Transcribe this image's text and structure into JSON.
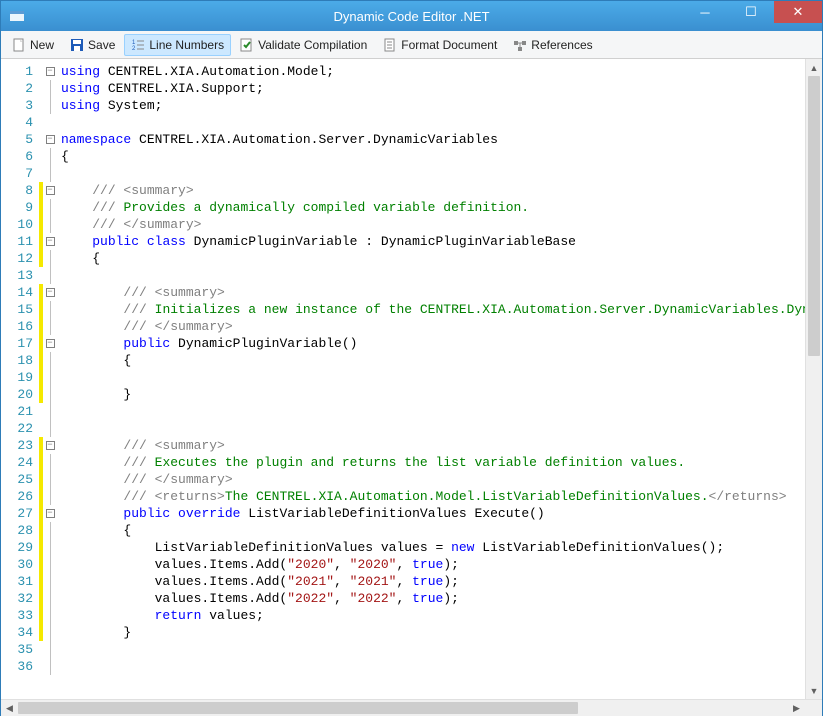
{
  "window": {
    "title": "Dynamic Code Editor .NET"
  },
  "toolbar": {
    "new": "New",
    "save": "Save",
    "lineNumbers": "Line Numbers",
    "validate": "Validate Compilation",
    "format": "Format Document",
    "references": "References"
  },
  "code": {
    "lines": [
      {
        "n": 1,
        "fold": "minus",
        "mod": false,
        "tokens": [
          [
            "kw",
            "using"
          ],
          [
            "",
            " CENTREL.XIA.Automation.Model;"
          ]
        ]
      },
      {
        "n": 2,
        "fold": "line",
        "mod": false,
        "tokens": [
          [
            "kw",
            "using"
          ],
          [
            "",
            " CENTREL.XIA.Support;"
          ]
        ]
      },
      {
        "n": 3,
        "fold": "line",
        "mod": false,
        "tokens": [
          [
            "kw",
            "using"
          ],
          [
            "",
            " System;"
          ]
        ]
      },
      {
        "n": 4,
        "fold": "",
        "mod": false,
        "tokens": [
          [
            "",
            ""
          ]
        ]
      },
      {
        "n": 5,
        "fold": "minus",
        "mod": false,
        "tokens": [
          [
            "kw",
            "namespace"
          ],
          [
            "",
            " CENTREL.XIA.Automation.Server.DynamicVariables"
          ]
        ]
      },
      {
        "n": 6,
        "fold": "line",
        "mod": false,
        "tokens": [
          [
            "",
            "{"
          ]
        ]
      },
      {
        "n": 7,
        "fold": "line",
        "mod": false,
        "tokens": [
          [
            "",
            ""
          ]
        ]
      },
      {
        "n": 8,
        "fold": "minus",
        "mod": true,
        "tokens": [
          [
            "",
            "    "
          ],
          [
            "xmlcom",
            "/// <summary>"
          ]
        ]
      },
      {
        "n": 9,
        "fold": "line",
        "mod": true,
        "tokens": [
          [
            "",
            "    "
          ],
          [
            "xmlcom",
            "/// "
          ],
          [
            "com",
            "Provides a dynamically compiled variable definition."
          ]
        ]
      },
      {
        "n": 10,
        "fold": "line",
        "mod": true,
        "tokens": [
          [
            "",
            "    "
          ],
          [
            "xmlcom",
            "/// </summary>"
          ]
        ]
      },
      {
        "n": 11,
        "fold": "minus",
        "mod": true,
        "tokens": [
          [
            "",
            "    "
          ],
          [
            "kw",
            "public"
          ],
          [
            "",
            " "
          ],
          [
            "kw",
            "class"
          ],
          [
            "",
            " DynamicPluginVariable : DynamicPluginVariableBase"
          ]
        ]
      },
      {
        "n": 12,
        "fold": "line",
        "mod": true,
        "tokens": [
          [
            "",
            "    {"
          ]
        ]
      },
      {
        "n": 13,
        "fold": "line",
        "mod": false,
        "tokens": [
          [
            "",
            ""
          ]
        ]
      },
      {
        "n": 14,
        "fold": "minus",
        "mod": true,
        "tokens": [
          [
            "",
            "        "
          ],
          [
            "xmlcom",
            "/// <summary>"
          ]
        ]
      },
      {
        "n": 15,
        "fold": "line",
        "mod": true,
        "tokens": [
          [
            "",
            "        "
          ],
          [
            "xmlcom",
            "/// "
          ],
          [
            "com",
            "Initializes a new instance of the CENTREL.XIA.Automation.Server.DynamicVariables.DynamicPl"
          ]
        ]
      },
      {
        "n": 16,
        "fold": "line",
        "mod": true,
        "tokens": [
          [
            "",
            "        "
          ],
          [
            "xmlcom",
            "/// </summary>"
          ]
        ]
      },
      {
        "n": 17,
        "fold": "minus",
        "mod": true,
        "tokens": [
          [
            "",
            "        "
          ],
          [
            "kw",
            "public"
          ],
          [
            "",
            " DynamicPluginVariable()"
          ]
        ]
      },
      {
        "n": 18,
        "fold": "line",
        "mod": true,
        "tokens": [
          [
            "",
            "        {"
          ]
        ]
      },
      {
        "n": 19,
        "fold": "line",
        "mod": true,
        "tokens": [
          [
            "",
            ""
          ]
        ]
      },
      {
        "n": 20,
        "fold": "line",
        "mod": true,
        "tokens": [
          [
            "",
            "        }"
          ]
        ]
      },
      {
        "n": 21,
        "fold": "line",
        "mod": false,
        "tokens": [
          [
            "",
            ""
          ]
        ]
      },
      {
        "n": 22,
        "fold": "line",
        "mod": false,
        "tokens": [
          [
            "",
            ""
          ]
        ]
      },
      {
        "n": 23,
        "fold": "minus",
        "mod": true,
        "tokens": [
          [
            "",
            "        "
          ],
          [
            "xmlcom",
            "/// <summary>"
          ]
        ]
      },
      {
        "n": 24,
        "fold": "line",
        "mod": true,
        "tokens": [
          [
            "",
            "        "
          ],
          [
            "xmlcom",
            "/// "
          ],
          [
            "com",
            "Executes the plugin and returns the list variable definition values."
          ]
        ]
      },
      {
        "n": 25,
        "fold": "line",
        "mod": true,
        "tokens": [
          [
            "",
            "        "
          ],
          [
            "xmlcom",
            "/// </summary>"
          ]
        ]
      },
      {
        "n": 26,
        "fold": "line",
        "mod": true,
        "tokens": [
          [
            "",
            "        "
          ],
          [
            "xmlcom",
            "/// <returns>"
          ],
          [
            "com",
            "The CENTREL.XIA.Automation.Model.ListVariableDefinitionValues."
          ],
          [
            "xmlcom",
            "</returns>"
          ]
        ]
      },
      {
        "n": 27,
        "fold": "minus",
        "mod": true,
        "tokens": [
          [
            "",
            "        "
          ],
          [
            "kw",
            "public"
          ],
          [
            "",
            " "
          ],
          [
            "kw",
            "override"
          ],
          [
            "",
            " ListVariableDefinitionValues Execute()"
          ]
        ]
      },
      {
        "n": 28,
        "fold": "line",
        "mod": true,
        "tokens": [
          [
            "",
            "        {"
          ]
        ]
      },
      {
        "n": 29,
        "fold": "line",
        "mod": true,
        "tokens": [
          [
            "",
            "            ListVariableDefinitionValues values = "
          ],
          [
            "kw",
            "new"
          ],
          [
            "",
            " ListVariableDefinitionValues();"
          ]
        ]
      },
      {
        "n": 30,
        "fold": "line",
        "mod": true,
        "tokens": [
          [
            "",
            "            values.Items.Add("
          ],
          [
            "str",
            "\"2020\""
          ],
          [
            "",
            ", "
          ],
          [
            "str",
            "\"2020\""
          ],
          [
            "",
            ", "
          ],
          [
            "kw",
            "true"
          ],
          [
            "",
            ");"
          ]
        ]
      },
      {
        "n": 31,
        "fold": "line",
        "mod": true,
        "tokens": [
          [
            "",
            "            values.Items.Add("
          ],
          [
            "str",
            "\"2021\""
          ],
          [
            "",
            ", "
          ],
          [
            "str",
            "\"2021\""
          ],
          [
            "",
            ", "
          ],
          [
            "kw",
            "true"
          ],
          [
            "",
            ");"
          ]
        ]
      },
      {
        "n": 32,
        "fold": "line",
        "mod": true,
        "tokens": [
          [
            "",
            "            values.Items.Add("
          ],
          [
            "str",
            "\"2022\""
          ],
          [
            "",
            ", "
          ],
          [
            "str",
            "\"2022\""
          ],
          [
            "",
            ", "
          ],
          [
            "kw",
            "true"
          ],
          [
            "",
            ");"
          ]
        ]
      },
      {
        "n": 33,
        "fold": "line",
        "mod": true,
        "tokens": [
          [
            "",
            "            "
          ],
          [
            "kw",
            "return"
          ],
          [
            "",
            " values;"
          ]
        ]
      },
      {
        "n": 34,
        "fold": "line",
        "mod": true,
        "tokens": [
          [
            "",
            "        }"
          ]
        ]
      },
      {
        "n": 35,
        "fold": "line",
        "mod": false,
        "tokens": [
          [
            "",
            ""
          ]
        ]
      },
      {
        "n": 36,
        "fold": "line",
        "mod": false,
        "tokens": [
          [
            "",
            ""
          ]
        ]
      }
    ]
  }
}
